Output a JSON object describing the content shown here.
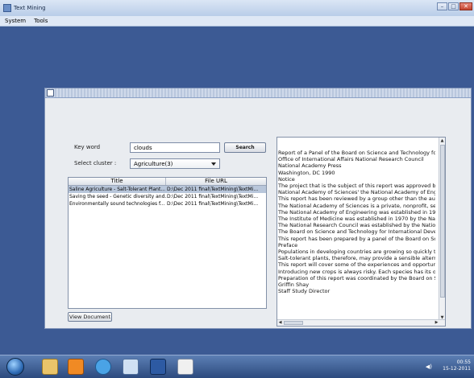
{
  "window": {
    "title": "Text Mining"
  },
  "menu": [
    "System",
    "Tools"
  ],
  "form": {
    "keyword_label": "Key word",
    "keyword_value": "clouds",
    "search_label": "Search",
    "cluster_label": "Select cluster :",
    "cluster_value": "Agriculture(3)",
    "view_document_label": "View Document"
  },
  "table": {
    "headers": [
      "Title",
      "File URL"
    ],
    "rows": [
      [
        "Saline Agriculture - Salt-Tolerant Plant...",
        "D:\\Dec  2011 final\\TextMining\\TextMi..."
      ],
      [
        "Saving the seed - Genetic diversity and...",
        "D:\\Dec  2011 final\\TextMining\\TextMi..."
      ],
      [
        "Environmentally sound technologies f...",
        "D:\\Dec  2011 final\\TextMining\\TextMi..."
      ]
    ]
  },
  "document_text": [
    "Report of a Panel of the Board on Science and Technology for Int",
    "Office of International Affairs National Research Council",
    "National Academy Press",
    "Washington, DC 1990",
    "Notice",
    "The project that is the subject of this report was approved by the",
    "National Academy of Sciences' the National Academy of Enginee",
    "This report has been reviewed by a group other than the authors",
    "The National Academy of Sciences is a private, nonprofit, self-pe",
    "The National Academy of Engineering was established in 1964, u",
    "The Institute of Medicine was established in 1970 by the National",
    "The National Research Council was established by the National A",
    "The Board on Science and Technology for International Developm",
    "This report has been prepared by a panel of the Board on Science",
    "Preface",
    "Populations in developing countries are growing so quickly that t",
    "Salt-tolerant plants, therefore, may provide a sensible alternative",
    "This report will cover some of the experiences and opportunities",
    "Introducing new crops is always risky. Each species has its own p",
    "Preparation of this report was coordinated by the Board on Scien",
    "Griffin Shay",
    "Staff Study Director"
  ],
  "taskbar": {
    "time": "00:55",
    "date": "15-12-2011"
  },
  "colors": {
    "desktop": "#3c5a94",
    "selection": "#b8c6da"
  }
}
